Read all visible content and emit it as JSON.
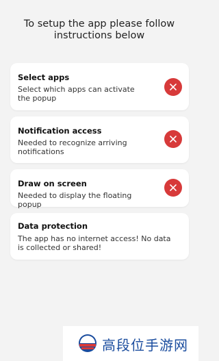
{
  "header": {
    "title": "To setup the app please follow instructions below"
  },
  "cards": [
    {
      "title": "Select apps",
      "desc": "Select which apps can activate the popup"
    },
    {
      "title": "Notification access",
      "desc": "Needed to recognize arriving notifications"
    },
    {
      "title": "Draw on screen",
      "desc": "Needed to display the floating popup"
    },
    {
      "title": "Data protection",
      "desc": "The app has no internet access! No data is collected or shared!"
    }
  ],
  "watermark": {
    "text": "高段位手游网"
  },
  "colors": {
    "accent_red": "#d73a3a",
    "background": "#f3f3f3",
    "card": "#ffffff"
  }
}
